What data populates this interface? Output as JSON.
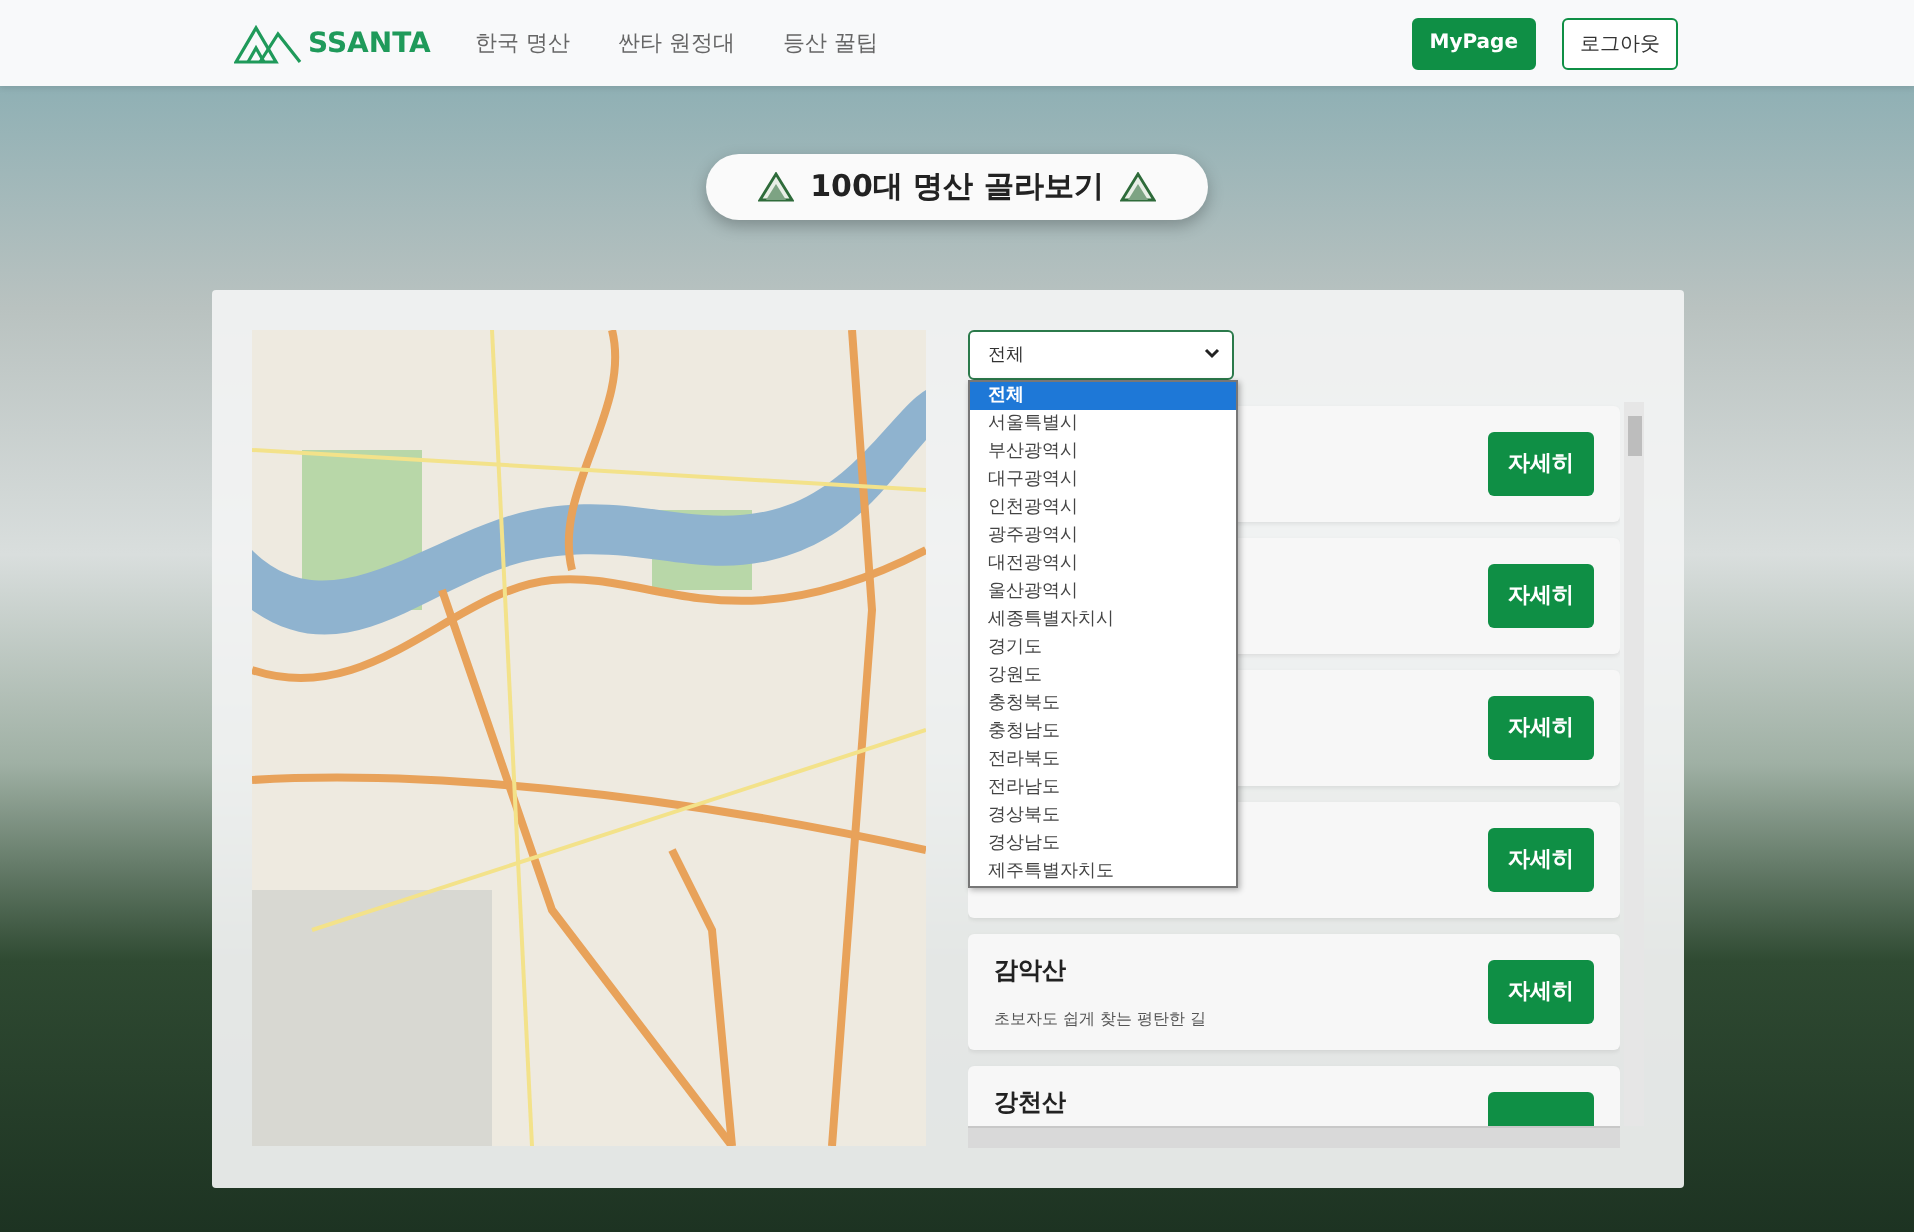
{
  "navbar": {
    "logo": "SSANTA",
    "links": [
      "한국 명산",
      "싼타 원정대",
      "등산 꿀팁"
    ],
    "buttons": [
      {
        "label": "MyPage",
        "kind": "primary"
      },
      {
        "label": "로그아웃",
        "kind": "outline"
      }
    ]
  },
  "heading": "100대 명산 골라보기",
  "region_select": {
    "value": "전체",
    "expanded": true,
    "options": [
      {
        "label": "전체",
        "selected": true
      },
      {
        "label": "서울특별시",
        "selected": false
      },
      {
        "label": "부산광역시",
        "selected": false
      },
      {
        "label": "대구광역시",
        "selected": false
      },
      {
        "label": "인천광역시",
        "selected": false
      },
      {
        "label": "광주광역시",
        "selected": false
      },
      {
        "label": "대전광역시",
        "selected": false
      },
      {
        "label": "울산광역시",
        "selected": false
      },
      {
        "label": "세종특별자치시",
        "selected": false
      },
      {
        "label": "경기도",
        "selected": false
      },
      {
        "label": "강원도",
        "selected": false
      },
      {
        "label": "충청북도",
        "selected": false
      },
      {
        "label": "충청남도",
        "selected": false
      },
      {
        "label": "전라북도",
        "selected": false
      },
      {
        "label": "전라남도",
        "selected": false
      },
      {
        "label": "경상북도",
        "selected": false
      },
      {
        "label": "경상남도",
        "selected": false
      },
      {
        "label": "제주특별자치도",
        "selected": false
      }
    ]
  },
  "mountains": [
    {
      "button": "자세히"
    },
    {
      "button": "자세히"
    },
    {
      "button": "자세히"
    },
    {
      "button": "자세히"
    },
    {
      "name": "감악산",
      "description": "초보자도 쉽게 찾는 평탄한 길",
      "button": "자세히"
    },
    {
      "name": "강천산"
    }
  ]
}
